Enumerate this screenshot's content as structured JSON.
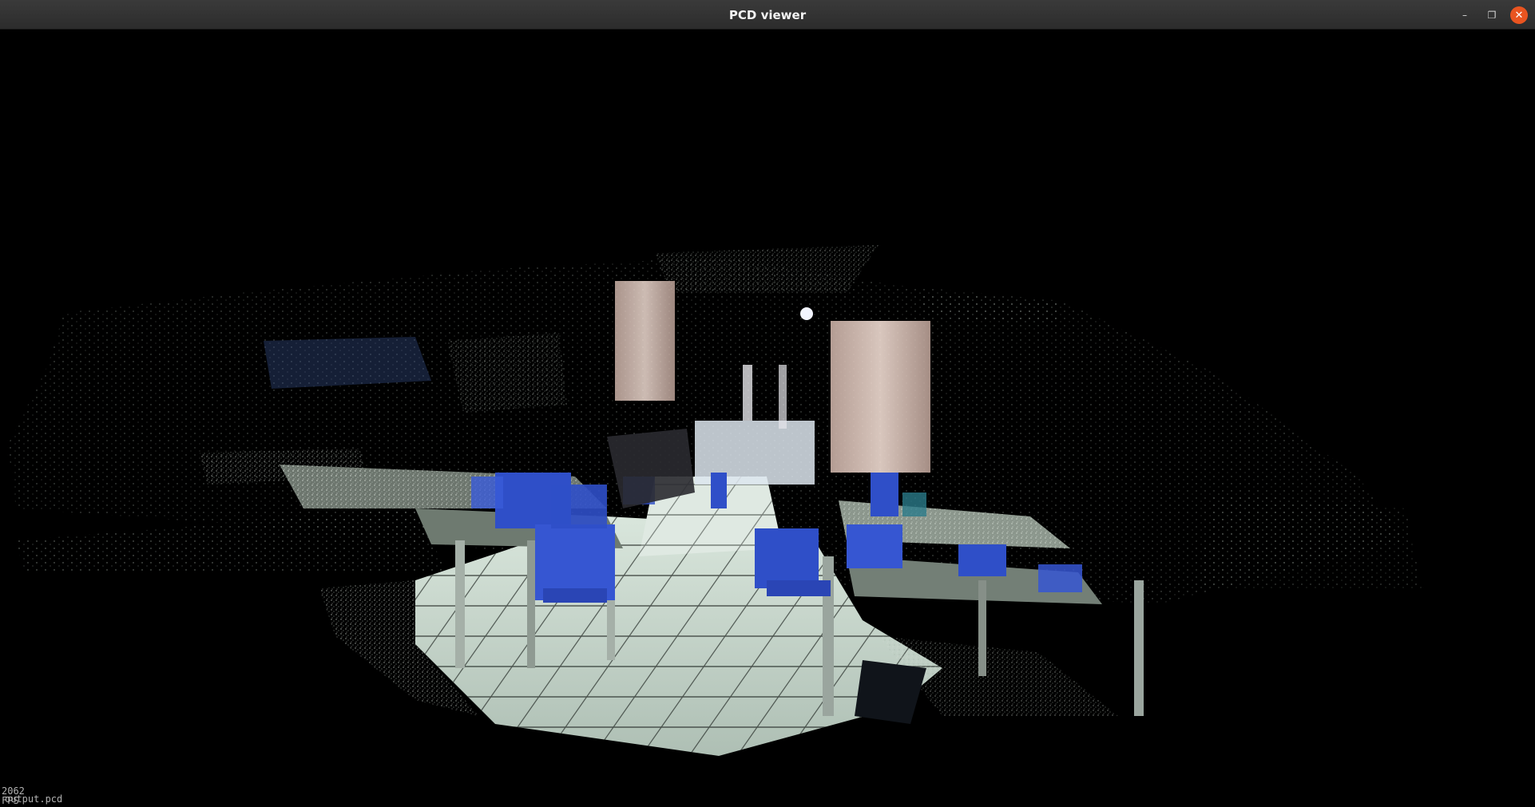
{
  "window": {
    "title": "PCD viewer",
    "controls": {
      "minimize": "–",
      "maximize": "❐",
      "close": "✕"
    }
  },
  "viewer": {
    "background": "#000000",
    "fps_text": "2062 FPS",
    "cloud_name": "output.pcd",
    "scene": "point cloud of a classroom with rows of desks and blue chairs, tiled floor, doorway with curtains in the back"
  },
  "colors": {
    "chairs": "#2f4fc8",
    "floor": "#c9d8cf",
    "curtain": "#e6cfc4",
    "close_button": "#e95420"
  }
}
